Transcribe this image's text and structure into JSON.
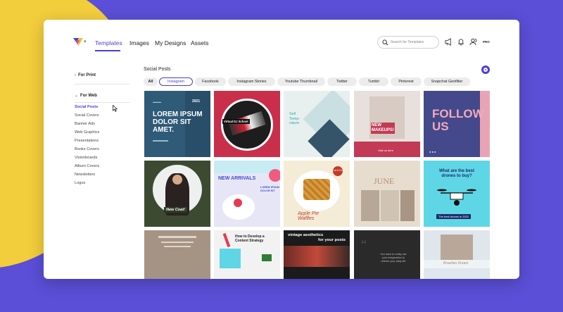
{
  "header": {
    "nav": [
      "Templates",
      "Images",
      "My Designs",
      "Assets"
    ],
    "search_placeholder": "Search for Templates",
    "avatar_text": "PRO"
  },
  "sidebar": {
    "for_print": "For Print",
    "for_web": "For Web",
    "items": [
      "Social Posts",
      "Social Covers",
      "Banner Ads",
      "Web Graphics",
      "Presentations",
      "Books Covers",
      "Visionboards",
      "Album Covers",
      "Newsletters",
      "Logos"
    ]
  },
  "main": {
    "title": "Social Posts",
    "filters": [
      "All",
      "Instagram",
      "Facebook",
      "Instagram Stories",
      "Youtube Thumbnail",
      "Twitter",
      "Tumblr",
      "Pinterest",
      "Snapchat Geofilter"
    ]
  },
  "tiles": {
    "t1": {
      "year": "2021",
      "headline_1": "LOREM IPSUM",
      "headline_2": "DOLOR SIT",
      "headline_3": "AMET."
    },
    "t2": {
      "label": "Virtual DJ School"
    },
    "t3": {
      "line1": "Sell",
      "line2": "Temp-",
      "line3": "rature"
    },
    "t4": {
      "line1": "NEW",
      "line2": "MAKEUPS!",
      "footer": "Visit us here"
    },
    "t5": {
      "line1": "FOLLOW",
      "line2": "US"
    },
    "t6": {
      "label": "New Coat!"
    },
    "t7": {
      "title": "NEW ARRIVALS",
      "side1": "LOREM IPSUM",
      "side2": "DOLOR SIT"
    },
    "t8": {
      "badge": "Let it Go",
      "line1": "Apple Pie",
      "line2": "Waffles"
    },
    "t9": {
      "title": "JUNE"
    },
    "t10": {
      "q1": "What are the best",
      "q2": "drones to buy?",
      "footer": "The best drones in 2021"
    },
    "t12": {
      "line1": "How to Develop a",
      "line2": "Content Strategy"
    },
    "t13": {
      "line1": "vintage aesthetics",
      "line2": "for your posts"
    },
    "t14": {
      "line1": "You have to really use",
      "line2": "your imagination to",
      "line3": "refresh your daily life"
    },
    "t15": {
      "title": "Brazilian Dream"
    }
  },
  "colors": {
    "background": "#5a4fd6",
    "accent": "#4b3fd1",
    "blob": "#f2cd3c"
  }
}
